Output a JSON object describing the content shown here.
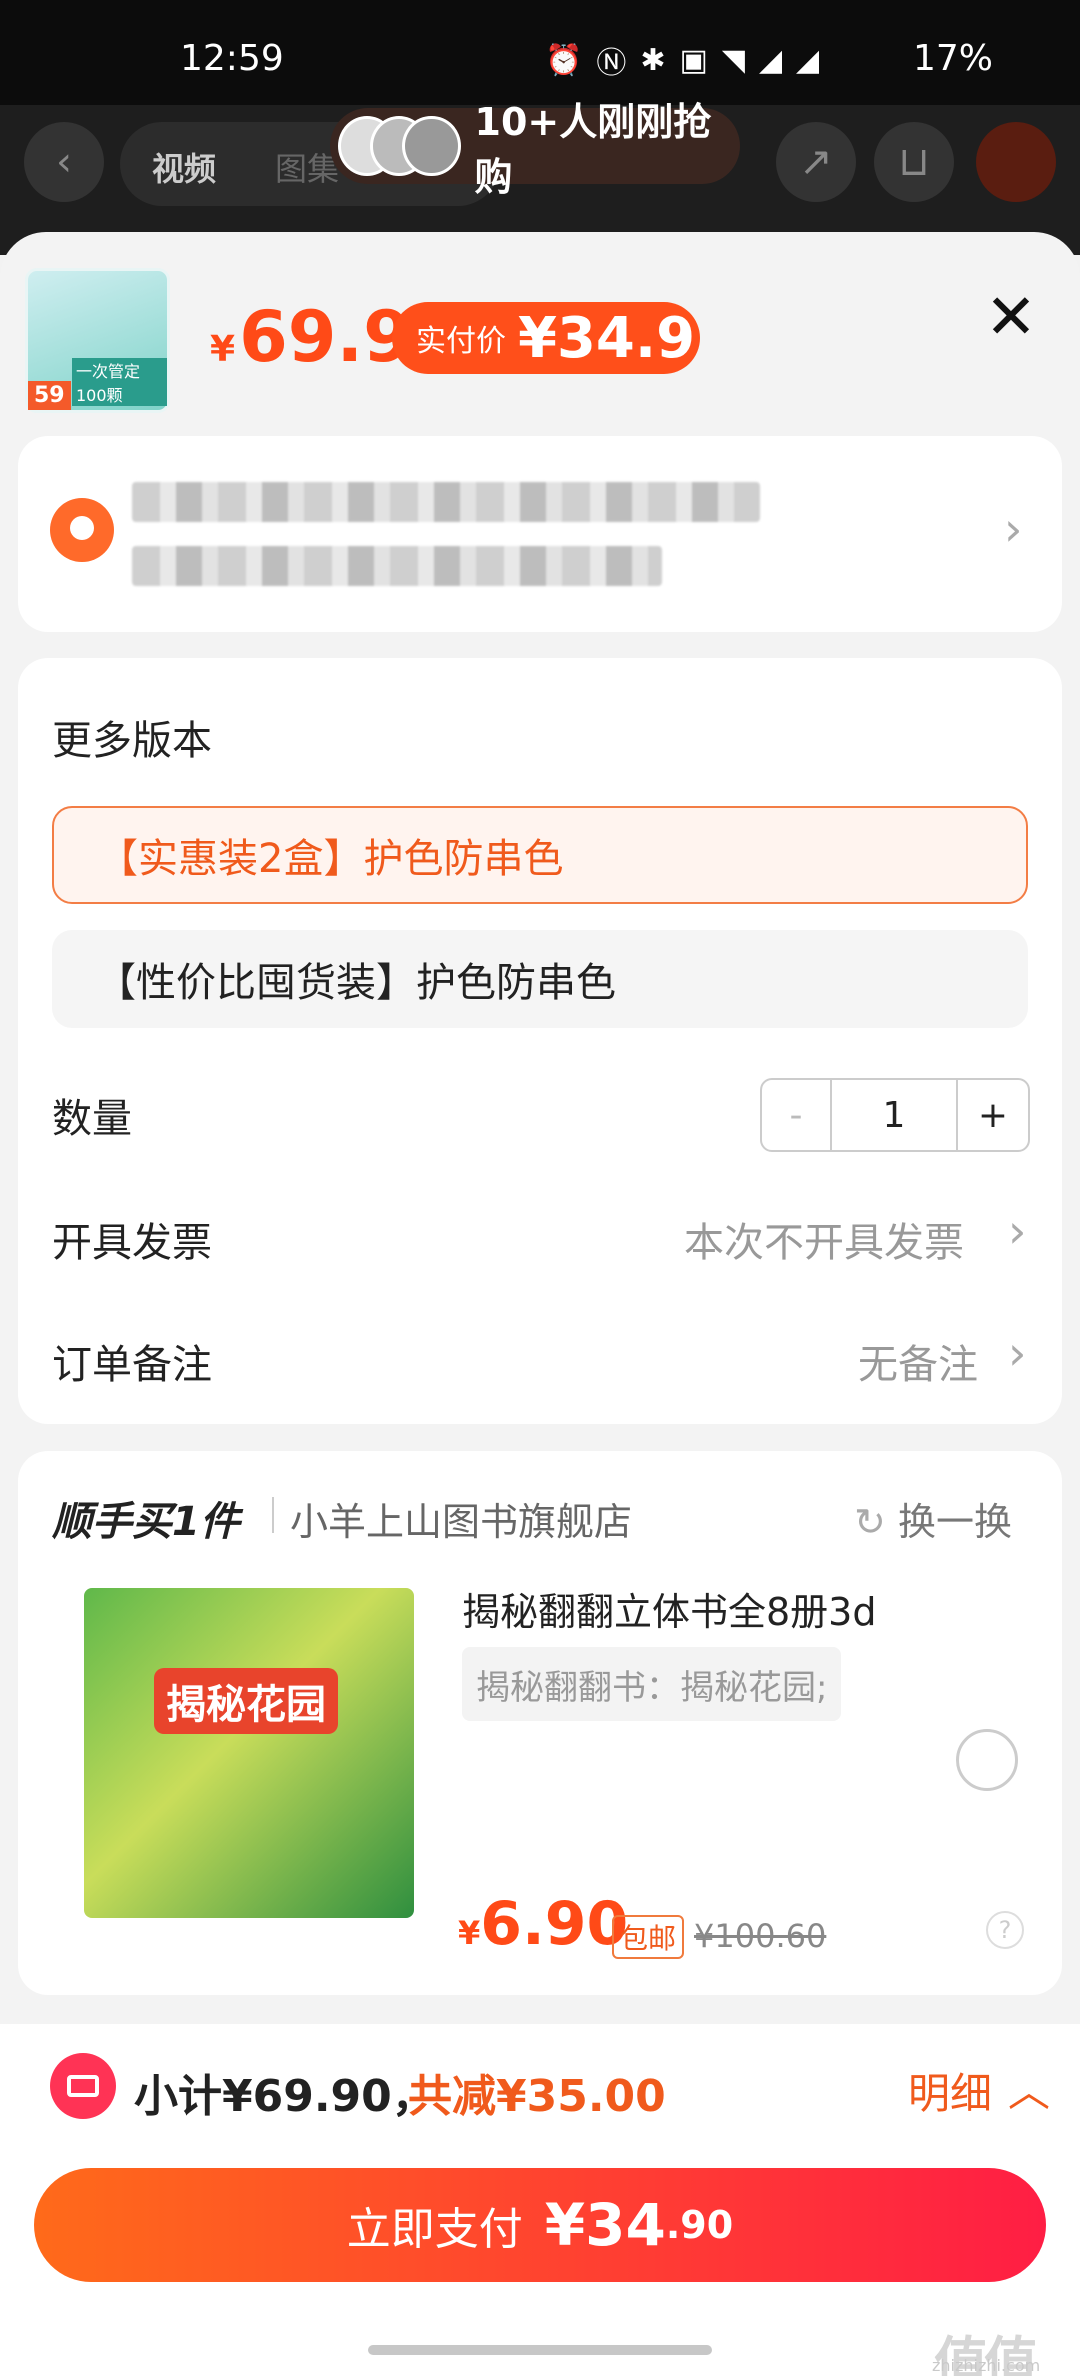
{
  "status_bar": {
    "time": "12:59",
    "icons": [
      "alarm-icon",
      "nfc-icon",
      "bluetooth-icon",
      "volte-icon",
      "wifi-icon",
      "signal-icon",
      "signal-r-icon"
    ],
    "battery": "17%"
  },
  "background_page": {
    "tab_video": "视频",
    "tab_gallery": "图集"
  },
  "toast": {
    "text": "10+人刚刚抢购"
  },
  "product": {
    "badge": "59",
    "strip": "一次管定100颗",
    "currency": "¥",
    "price": "69.9",
    "real_price_label": "实付价",
    "real_price_value": "¥34.9"
  },
  "options": {
    "section_title": "更多版本",
    "items": [
      {
        "label": "【实惠装2盒】护色防串色",
        "selected": true
      },
      {
        "label": "【性价比囤货装】护色防串色",
        "selected": false
      }
    ],
    "quantity_label": "数量",
    "quantity_minus": "-",
    "quantity_value": "1",
    "quantity_plus": "+",
    "invoice_label": "开具发票",
    "invoice_value": "本次不开具发票",
    "remark_label": "订单备注",
    "remark_value": "无备注"
  },
  "bundle": {
    "heading": "顺手买1件",
    "store": "小羊上山图书旗舰店",
    "swap": "换一换",
    "book_cover_text": "揭秘花园",
    "title": "揭秘翻翻立体书全8册3d",
    "sku": "揭秘翻翻书：揭秘花园;",
    "currency": "¥",
    "price": "6.90",
    "free_shipping": "包邮",
    "original_price": "¥100.60"
  },
  "footer": {
    "subtotal": "小计¥69.90，",
    "discount": "共减¥35.00",
    "detail": "明细",
    "pay_label": "立即支付",
    "pay_amount": "¥34",
    "pay_cents": ".90"
  },
  "colors": {
    "accent": "#ff4a17",
    "pay_gradient_end": "#ff1e44"
  },
  "watermark": {
    "glyphs": "值值值",
    "site": "zhizhizhi.com"
  }
}
